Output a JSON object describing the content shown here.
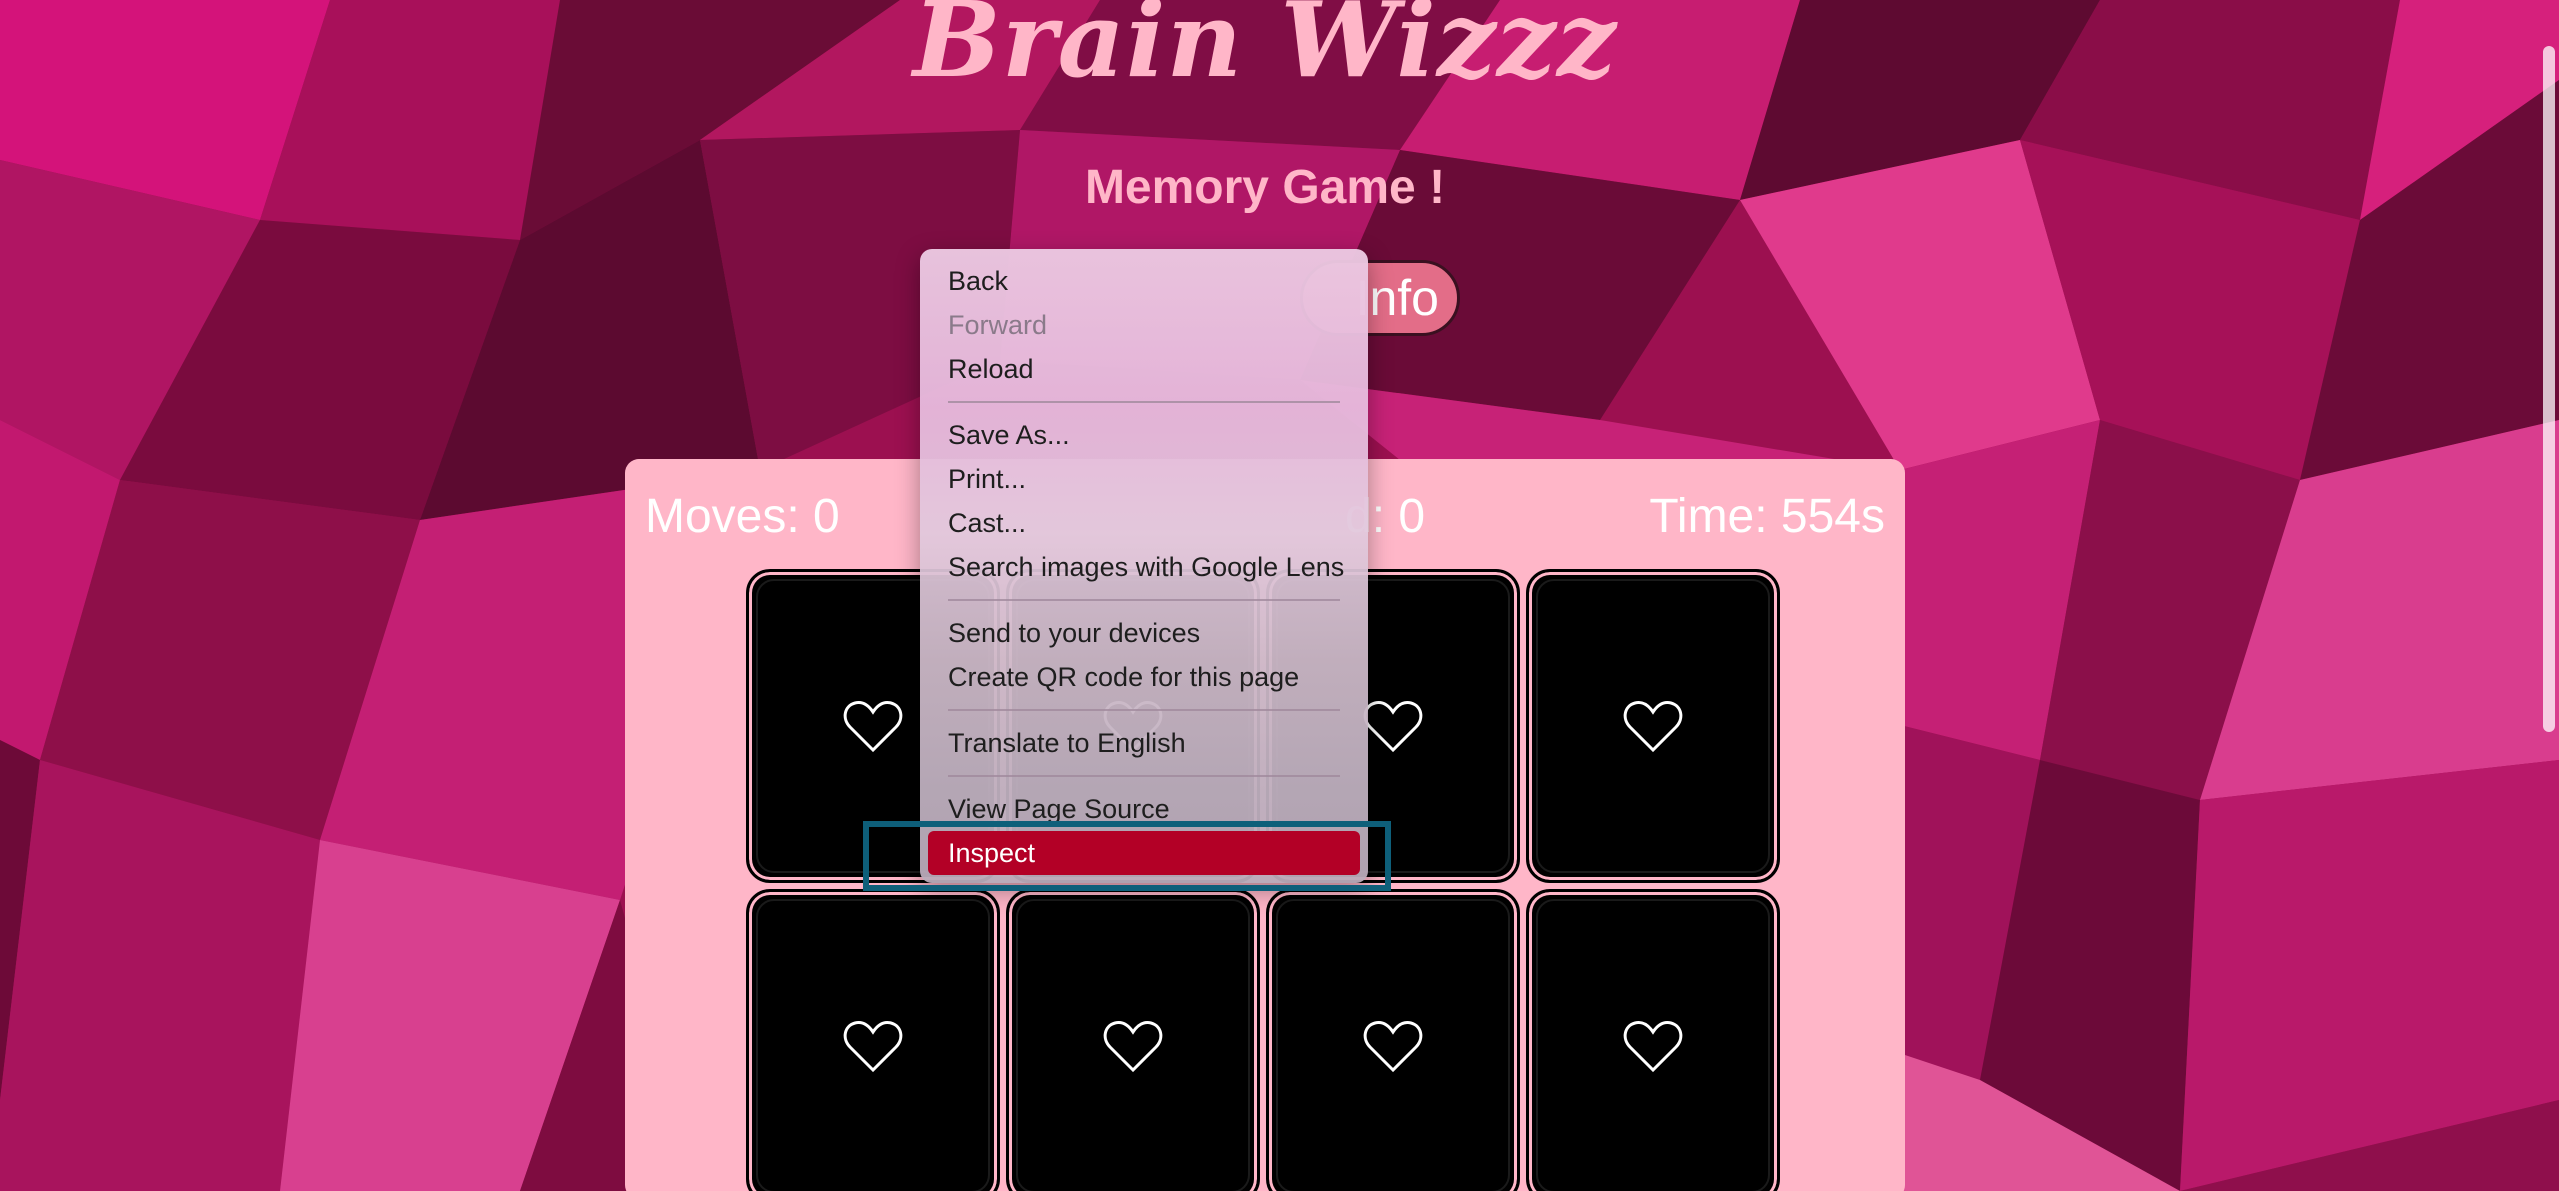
{
  "page": {
    "title": "Brain Wizzz",
    "subtitle": "Memory Game !",
    "info_button_label": "Info"
  },
  "stats": {
    "moves": "Moves: 0",
    "matched": "d: 0",
    "time": "Time: 554s"
  },
  "cards": {
    "icon": "heart-outline-icon",
    "count": 8
  },
  "context_menu": {
    "items": [
      {
        "label": "Back",
        "enabled": true
      },
      {
        "label": "Forward",
        "enabled": false
      },
      {
        "label": "Reload",
        "enabled": true
      },
      {
        "label": "Save As...",
        "enabled": true
      },
      {
        "label": "Print...",
        "enabled": true
      },
      {
        "label": "Cast...",
        "enabled": true
      },
      {
        "label": "Search images with Google Lens",
        "enabled": true
      },
      {
        "label": "Send to your devices",
        "enabled": true
      },
      {
        "label": "Create QR code for this page",
        "enabled": true
      },
      {
        "label": "Translate to English",
        "enabled": true
      },
      {
        "label": "View Page Source",
        "enabled": true
      },
      {
        "label": "Inspect",
        "enabled": true,
        "highlighted": true
      }
    ]
  },
  "colors": {
    "accent_pink": "#ffb6c8",
    "background": "#a3124f",
    "menu_highlight": "#b30026",
    "annotation_box": "#0e5f7a"
  }
}
